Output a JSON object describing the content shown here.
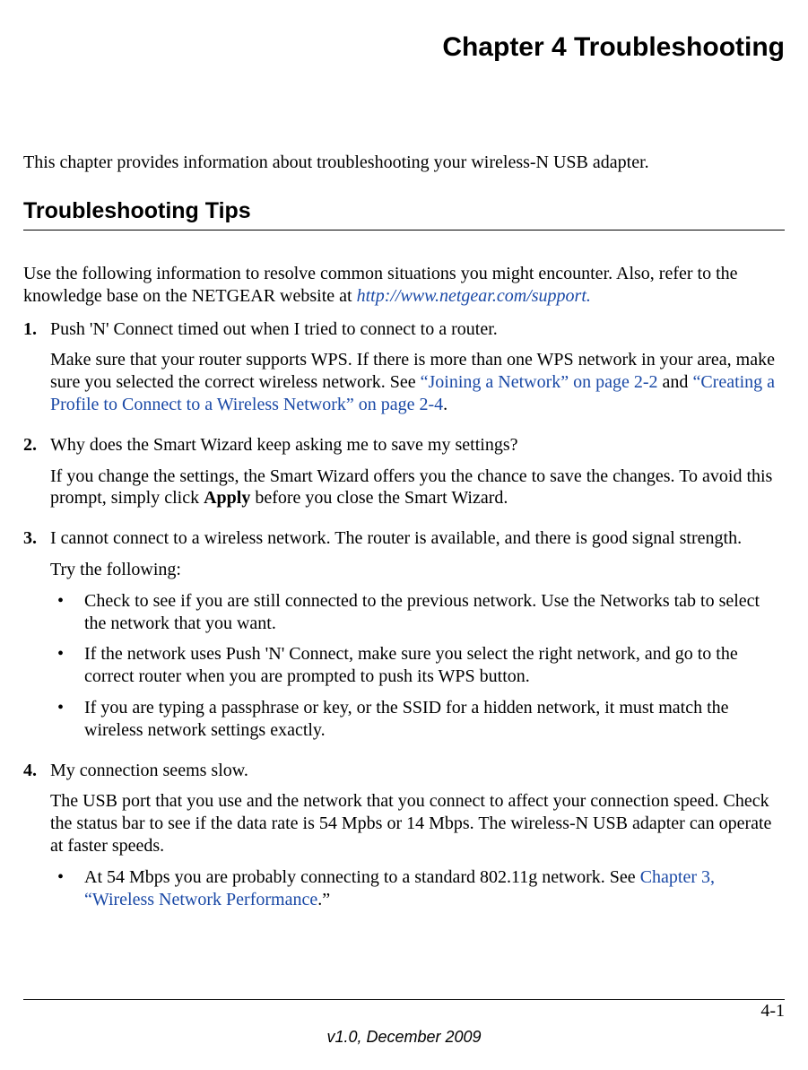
{
  "chapter_title": "Chapter 4 Troubleshooting",
  "intro": "This chapter provides information about troubleshooting your wireless-N USB adapter.",
  "section_heading": "Troubleshooting Tips",
  "lead_in_a": "Use the following information to resolve common situations you might encounter. Also, refer to the knowledge base on the NETGEAR website at ",
  "lead_in_link": "http://www.netgear.com/support.",
  "items": {
    "n1": "1.",
    "q1": "Push 'N' Connect timed out when I tried to connect to a router.",
    "a1a": "Make sure that your router supports WPS. If there is more than one WPS network in your area, make sure you selected the correct wireless network. See ",
    "a1_link1": "“Joining a Network” on page 2-2",
    "a1_mid": " and ",
    "a1_link2": "“Creating a Profile to Connect to a Wireless Network” on page 2-4",
    "a1_end": ".",
    "n2": "2.",
    "q2": "Why does the Smart Wizard keep asking me to save my settings?",
    "a2a": "If you change the settings, the Smart Wizard offers you the chance to save the changes. To avoid this prompt, simply click ",
    "a2_bold": "Apply",
    "a2b": " before you close the Smart Wizard.",
    "n3": "3.",
    "q3": "I cannot connect to a wireless network. The router is available, and there is good signal strength.",
    "a3_intro": "Try the following:",
    "a3_b1": "Check to see if you are still connected to the previous network. Use the Networks tab to select the network that you want.",
    "a3_b2": "If the network uses Push 'N' Connect, make sure you select the right network, and go to the correct router when you are prompted to push its WPS button.",
    "a3_b3": "If you are typing a passphrase or key, or the SSID for a hidden network, it must match the wireless network settings exactly.",
    "n4": "4.",
    "q4": "My connection seems slow.",
    "a4a": "The USB port that you use and the network that you connect to affect your connection speed. Check the status bar to see if the data rate is 54 Mpbs or 14 Mbps. The wireless-N USB adapter can operate at faster speeds.",
    "a4_b1a": "At 54 Mbps you are probably connecting to a standard 802.11g network. See ",
    "a4_b1_link": "Chapter 3, “Wireless Network Performance",
    "a4_b1b": ".”"
  },
  "bullet": "•",
  "page_num": "4-1",
  "version": "v1.0, December 2009"
}
